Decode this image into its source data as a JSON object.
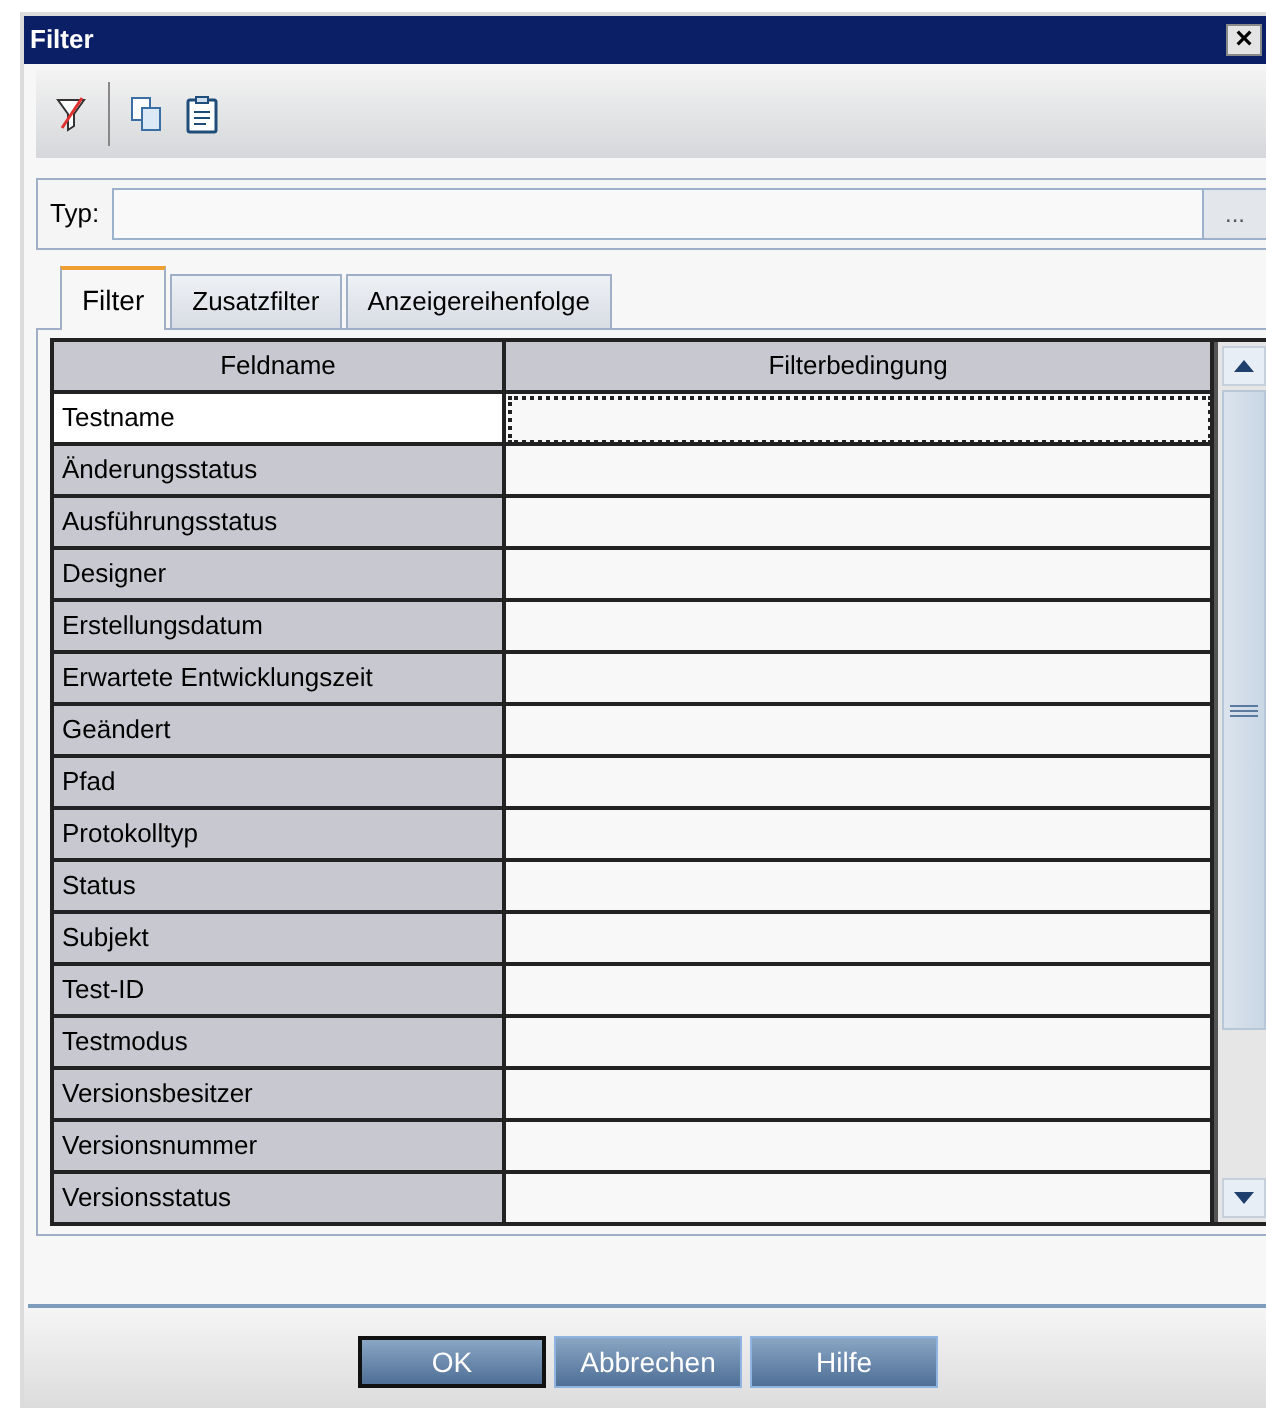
{
  "window": {
    "title": "Filter",
    "close": "×"
  },
  "type_field": {
    "label": "Typ:",
    "browse": "..."
  },
  "tabs": [
    {
      "label": "Filter",
      "selected": true
    },
    {
      "label": "Zusatzfilter",
      "selected": false
    },
    {
      "label": "Anzeigereihenfolge",
      "selected": false
    }
  ],
  "table": {
    "columns": [
      "Feldname",
      "Filterbedingung"
    ],
    "rows": [
      {
        "field": "Testname",
        "selected": true
      },
      {
        "field": "Änderungsstatus",
        "selected": false
      },
      {
        "field": "Ausführungsstatus",
        "selected": false
      },
      {
        "field": "Designer",
        "selected": false
      },
      {
        "field": "Erstellungsdatum",
        "selected": false
      },
      {
        "field": "Erwartete Entwicklungszeit",
        "selected": false
      },
      {
        "field": "Geändert",
        "selected": false
      },
      {
        "field": "Pfad",
        "selected": false
      },
      {
        "field": "Protokolltyp",
        "selected": false
      },
      {
        "field": "Status",
        "selected": false
      },
      {
        "field": "Subjekt",
        "selected": false
      },
      {
        "field": "Test-ID",
        "selected": false
      },
      {
        "field": "Testmodus",
        "selected": false
      },
      {
        "field": "Versionsbesitzer",
        "selected": false
      },
      {
        "field": "Versionsnummer",
        "selected": false
      },
      {
        "field": "Versionsstatus",
        "selected": false
      }
    ]
  },
  "buttons": [
    {
      "label": "OK",
      "default": true
    },
    {
      "label": "Abbrechen",
      "default": false
    },
    {
      "label": "Hilfe",
      "default": false
    }
  ]
}
